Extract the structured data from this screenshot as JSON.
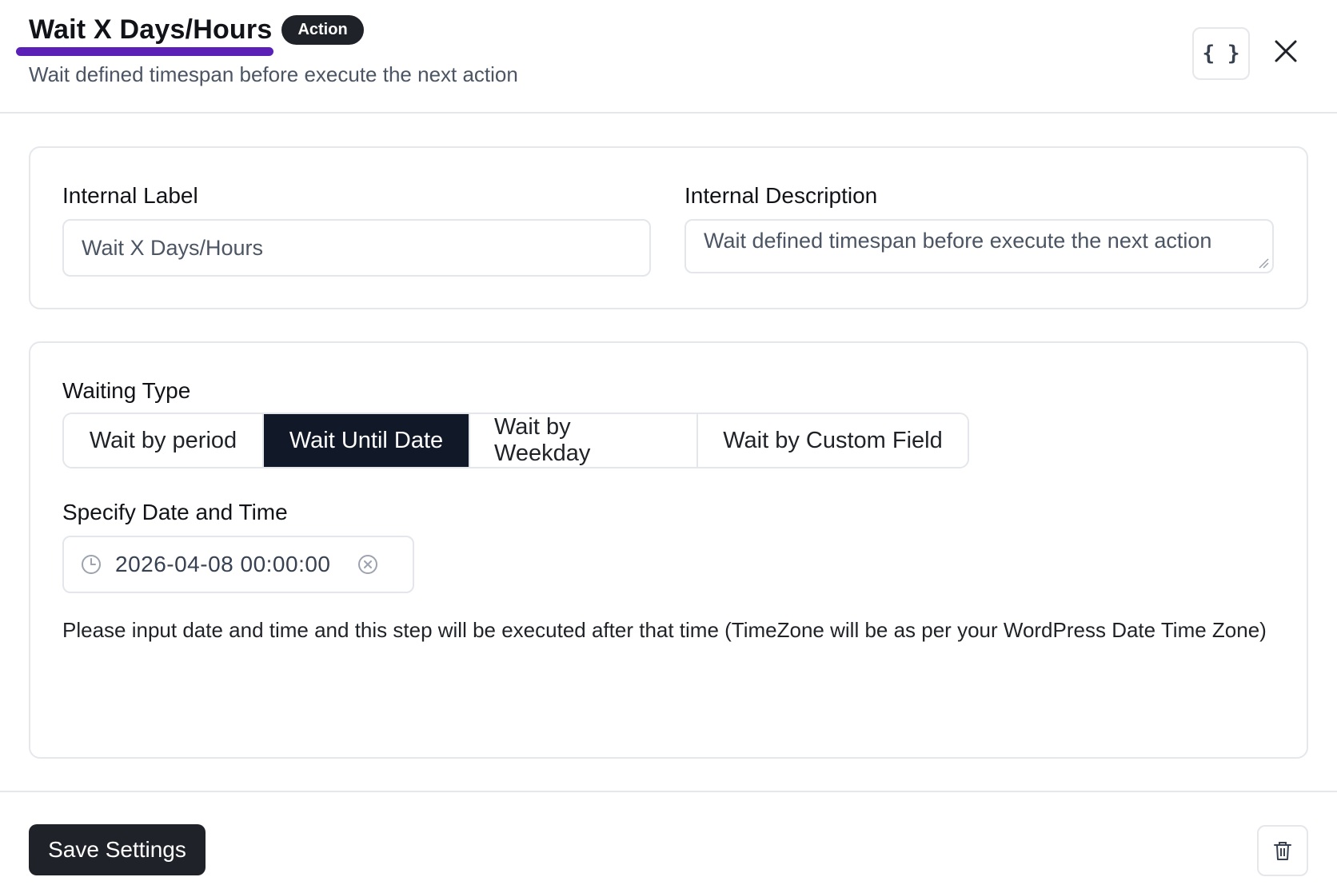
{
  "header": {
    "title": "Wait X Days/Hours",
    "badge": "Action",
    "subtitle": "Wait defined timespan before execute the next action",
    "code_button_label": "{ }"
  },
  "general": {
    "internal_label_title": "Internal Label",
    "internal_label_value": "Wait X Days/Hours",
    "internal_description_title": "Internal Description",
    "internal_description_value": "Wait defined timespan before execute the next action"
  },
  "waiting": {
    "type_title": "Waiting Type",
    "options": [
      {
        "label": "Wait by period",
        "active": false
      },
      {
        "label": "Wait Until Date",
        "active": true
      },
      {
        "label": "Wait by Weekday",
        "active": false
      },
      {
        "label": "Wait by Custom Field",
        "active": false
      }
    ],
    "date_title": "Specify Date and Time",
    "date_value": "2026-04-08 00:00:00",
    "help_text": "Please input date and time and this step will be executed after that time (TimeZone will be as per your WordPress Date Time Zone)"
  },
  "footer": {
    "save_label": "Save Settings"
  },
  "colors": {
    "accent_underline": "#5b21b6",
    "dark": "#111827",
    "border": "#e5e7eb"
  },
  "icons": [
    "code-braces-icon",
    "close-icon",
    "clock-icon",
    "clear-circle-icon",
    "trash-icon"
  ]
}
